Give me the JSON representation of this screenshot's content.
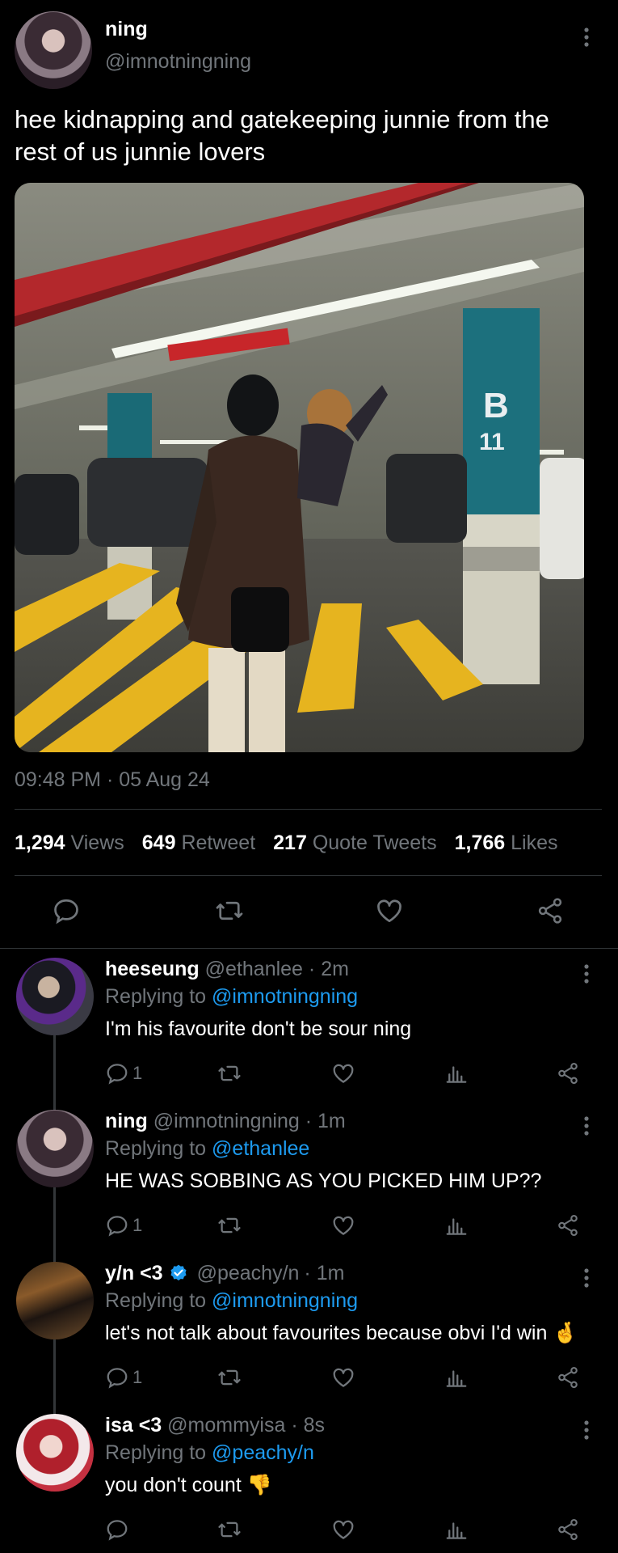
{
  "tweet": {
    "author": {
      "display_name": "ning",
      "handle": "@imnotningning"
    },
    "text_line1": "hee kidnapping and gatekeeping junnie from the",
    "text_line2": "rest of us junnie lovers",
    "timestamp": "09:48 PM · 05 Aug 24",
    "stats": {
      "views_count": "1,294",
      "views_label": "Views",
      "retweets_count": "649",
      "retweets_label": "Retweet",
      "quotes_count": "217",
      "quotes_label": "Quote Tweets",
      "likes_count": "1,766",
      "likes_label": "Likes"
    },
    "sign": {
      "text": "B",
      "number": "11"
    }
  },
  "replies": [
    {
      "display_name": "heeseung",
      "handle": "@ethanlee",
      "time": "· 2m",
      "replying_prefix": "Replying to",
      "replying_to": "@imnotningning",
      "text": "I'm his favourite don't be sour ning",
      "reply_count": "1"
    },
    {
      "display_name": "ning",
      "handle": "@imnotningning",
      "time": "· 1m",
      "replying_prefix": "Replying to",
      "replying_to": "@ethanlee",
      "text": "HE WAS SOBBING AS YOU PICKED HIM UP??",
      "reply_count": "1"
    },
    {
      "display_name": "y/n <3",
      "handle": "@peachy/n",
      "time": "· 1m",
      "replying_prefix": "Replying to",
      "replying_to": "@imnotningning",
      "text": "let's not talk about favourites because obvi I'd win 🤞",
      "reply_count": "1"
    },
    {
      "display_name": "isa <3",
      "handle": "@mommyisa",
      "time": "· 8s",
      "replying_prefix": "Replying to",
      "replying_to": "@peachy/n",
      "text": "you don't count 👎",
      "reply_count": ""
    }
  ],
  "colors": {
    "background": "#000000",
    "text": "#e7e9ea",
    "muted": "#71767b",
    "link": "#1d9bf0",
    "verified": "#1d9bf0"
  }
}
